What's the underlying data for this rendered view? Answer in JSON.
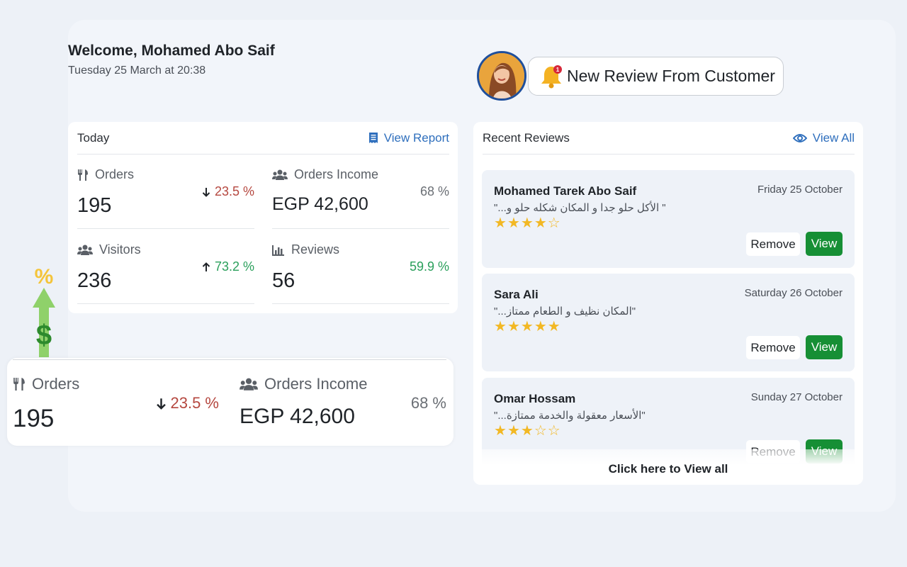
{
  "header": {
    "welcome": "Welcome, Mohamed Abo Saif",
    "datetime": "Tuesday 25 March at 20:38",
    "notification": {
      "text": "New Review From Customer",
      "badge": "1",
      "icon": "bell-icon"
    }
  },
  "today": {
    "title": "Today",
    "view_report": "View Report",
    "stats": [
      {
        "label": "Orders",
        "value": "195",
        "change": "23.5 %",
        "trend": "down",
        "icon": "utensils-icon"
      },
      {
        "label": "Orders Income",
        "value": "EGP 42,600",
        "change": "68 %",
        "trend": "neutral",
        "icon": "users-icon"
      },
      {
        "label": "Visitors",
        "value": "236",
        "change": "73.2 %",
        "trend": "up",
        "icon": "users-icon"
      },
      {
        "label": "Reviews",
        "value": "56",
        "change": "59.9 %",
        "trend": "neutral-green",
        "icon": "bar-chart-icon"
      }
    ]
  },
  "recent_reviews": {
    "title": "Recent Reviews",
    "view_all": "View All",
    "items": [
      {
        "name": "Mohamed Tarek Abo Saif",
        "date": "Friday 25 October",
        "text": "\" الأكل حلو جدا و المكان شكله حلو و...\"",
        "rating": 4,
        "remove": "Remove",
        "view": "View"
      },
      {
        "name": "Sara Ali",
        "date": "Saturday 26 October",
        "text": "\"المكان نظيف و الطعام ممتاز...\"",
        "rating": 5,
        "remove": "Remove",
        "view": "View"
      },
      {
        "name": "Omar Hossam",
        "date": "Sunday 27 October",
        "text": "\"الأسعار معقولة والخدمة ممتازة...\"",
        "rating": 3,
        "remove": "Remove",
        "view": "View"
      }
    ],
    "view_all_overlay": "Click here to View all"
  },
  "colors": {
    "accent_blue": "#2f6fbd",
    "down_red": "#b5473f",
    "up_green": "#2a9f5b",
    "view_button": "#168f35",
    "star": "#f2b824"
  }
}
